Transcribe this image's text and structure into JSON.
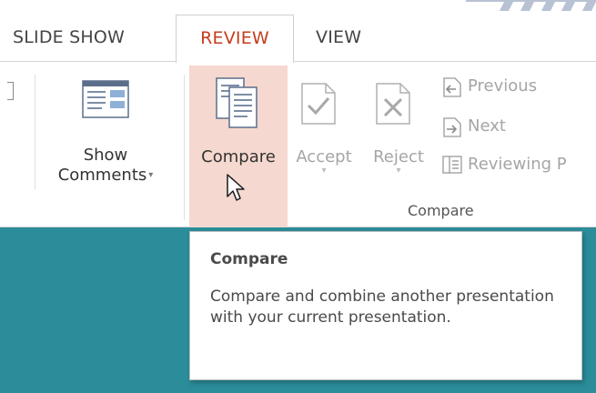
{
  "tabs": {
    "slide_show": "SLIDE SHOW",
    "review": "REVIEW",
    "view": "VIEW"
  },
  "ribbon": {
    "show_comments": {
      "line1": "Show",
      "line2": "Comments",
      "icon": "show-comments-icon"
    },
    "compare": {
      "label": "Compare",
      "icon": "compare-icon"
    },
    "accept": {
      "label": "Accept",
      "icon": "accept-icon"
    },
    "reject": {
      "label": "Reject",
      "icon": "reject-icon"
    },
    "previous": {
      "label": "Previous",
      "icon": "previous-change-icon"
    },
    "next": {
      "label": "Next",
      "icon": "next-change-icon"
    },
    "reviewing_pane": {
      "label": "Reviewing P",
      "icon": "reviewing-pane-icon"
    },
    "group_label": "Compare"
  },
  "tooltip": {
    "title": "Compare",
    "description": "Compare and combine another presentation with your current presentation."
  },
  "colors": {
    "accent": "#c43e1c",
    "compare_highlight": "#f5d8cf",
    "slide_background": "#2a8d99"
  }
}
